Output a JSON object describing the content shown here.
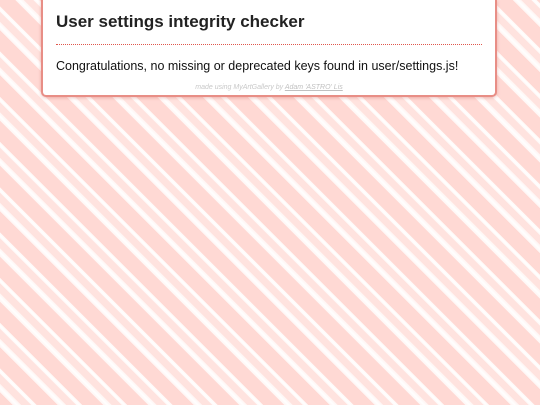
{
  "card": {
    "title": "User settings integrity checker",
    "message": "Congratulations, no missing or deprecated keys found in user/settings.js!",
    "credit_prefix": "made using MyArtGallery by",
    "credit_author": "Adam 'ASTRO' Lis"
  },
  "colors": {
    "background_stripe": "#ffd9d4",
    "card_border": "#e88e86",
    "divider": "#e0574c"
  }
}
